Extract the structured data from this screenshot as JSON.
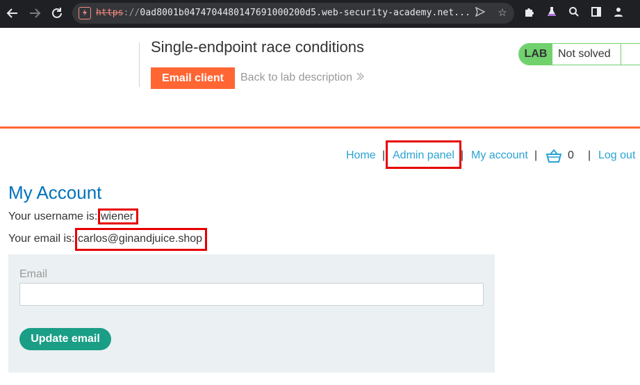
{
  "browser": {
    "url_scheme": "https",
    "url_separator": "://",
    "url_rest": "0ad8001b0474704480147691000200d5.web-security-academy.net..."
  },
  "lab": {
    "title": "Single-endpoint race conditions",
    "email_client_label": "Email client",
    "back_link_label": "Back to lab description",
    "status_badge": "LAB",
    "status_text": "Not solved"
  },
  "nav": {
    "home": "Home",
    "admin_panel": "Admin panel",
    "my_account": "My account",
    "cart_count": "0",
    "logout": "Log out",
    "separator": "|"
  },
  "account": {
    "heading": "My Account",
    "username_label": "Your username is:",
    "username_value": "wiener",
    "email_label": "Your email is:",
    "email_value": "carlos@ginandjuice.shop"
  },
  "form": {
    "email_field_label": "Email",
    "email_value": "",
    "submit_label": "Update email"
  },
  "colors": {
    "accent_orange": "#ff6633",
    "link_blue": "#29a3d3",
    "heading_blue": "#0071bc",
    "button_teal": "#1a9e86",
    "lab_green": "#70d16d",
    "highlight_red": "#e60000"
  }
}
